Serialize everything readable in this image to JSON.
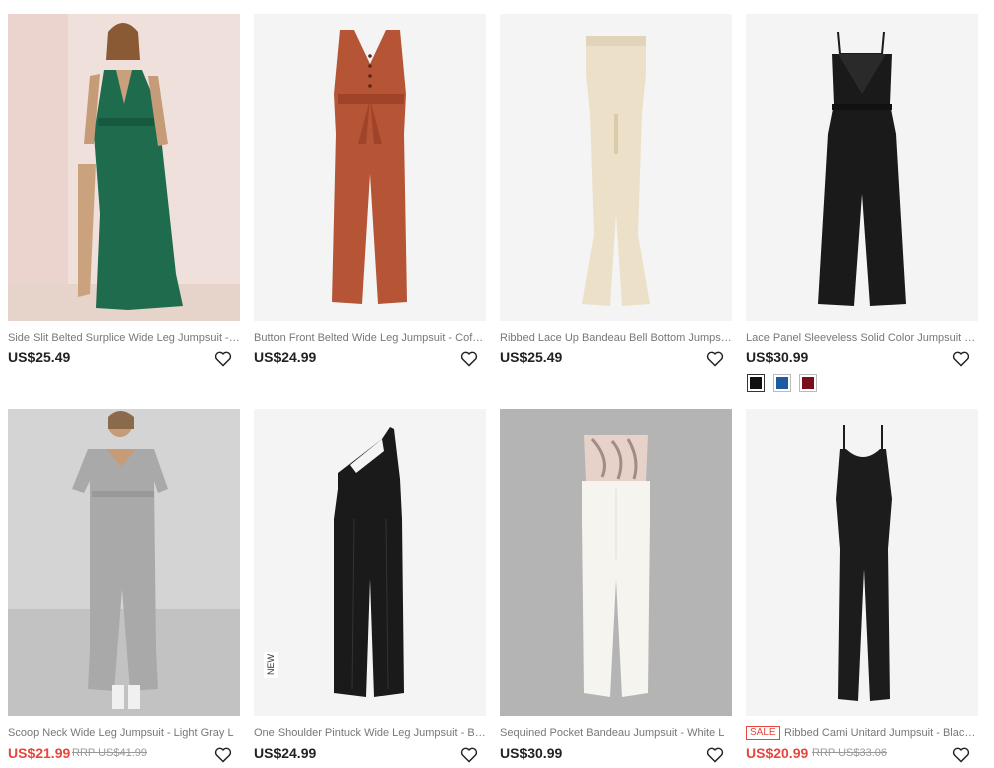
{
  "products": [
    {
      "title": "Side Slit Belted Surplice Wide Leg Jumpsuit - Gre...",
      "price": "US$25.49",
      "color": "#1f6b4e",
      "bg": "#f1e3de"
    },
    {
      "title": "Button Front Belted Wide Leg Jumpsuit - Coffee M",
      "price": "US$24.99",
      "color": "#b65536",
      "bg": "#f4f4f4"
    },
    {
      "title": "Ribbed Lace Up Bandeau Bell Bottom Jumpsuit - ...",
      "price": "US$25.49",
      "color": "#ece0c8",
      "bg": "#f4f4f4"
    },
    {
      "title": "Lace Panel Sleeveless Solid Color Jumpsuit - Blac...",
      "price": "US$30.99",
      "color": "#1a1a1a",
      "bg": "#f4f4f4",
      "swatches": [
        "#111111",
        "#1f5aa0",
        "#7a0f1c"
      ]
    },
    {
      "title": "Scoop Neck Wide Leg Jumpsuit - Light Gray L",
      "price": "US$21.99",
      "rrp": "RRP US$41.99",
      "color": "#a9a9a9",
      "bg": "#d2d2d2"
    },
    {
      "title": "One Shoulder Pintuck Wide Leg Jumpsuit - Black S",
      "price": "US$24.99",
      "badge": "NEW",
      "color": "#1a1a1a",
      "bg": "#f4f4f4"
    },
    {
      "title": "Sequined Pocket Bandeau Jumpsuit - White L",
      "price": "US$30.99",
      "color": "#f6f4ef",
      "bg": "#b4b4b4"
    },
    {
      "title": "Ribbed Cami Unitard Jumpsuit - Black L",
      "price": "US$20.99",
      "rrp": "RRP US$33.06",
      "sale_tag": "SALE",
      "color": "#1c1c1c",
      "bg": "#f4f4f4"
    }
  ]
}
